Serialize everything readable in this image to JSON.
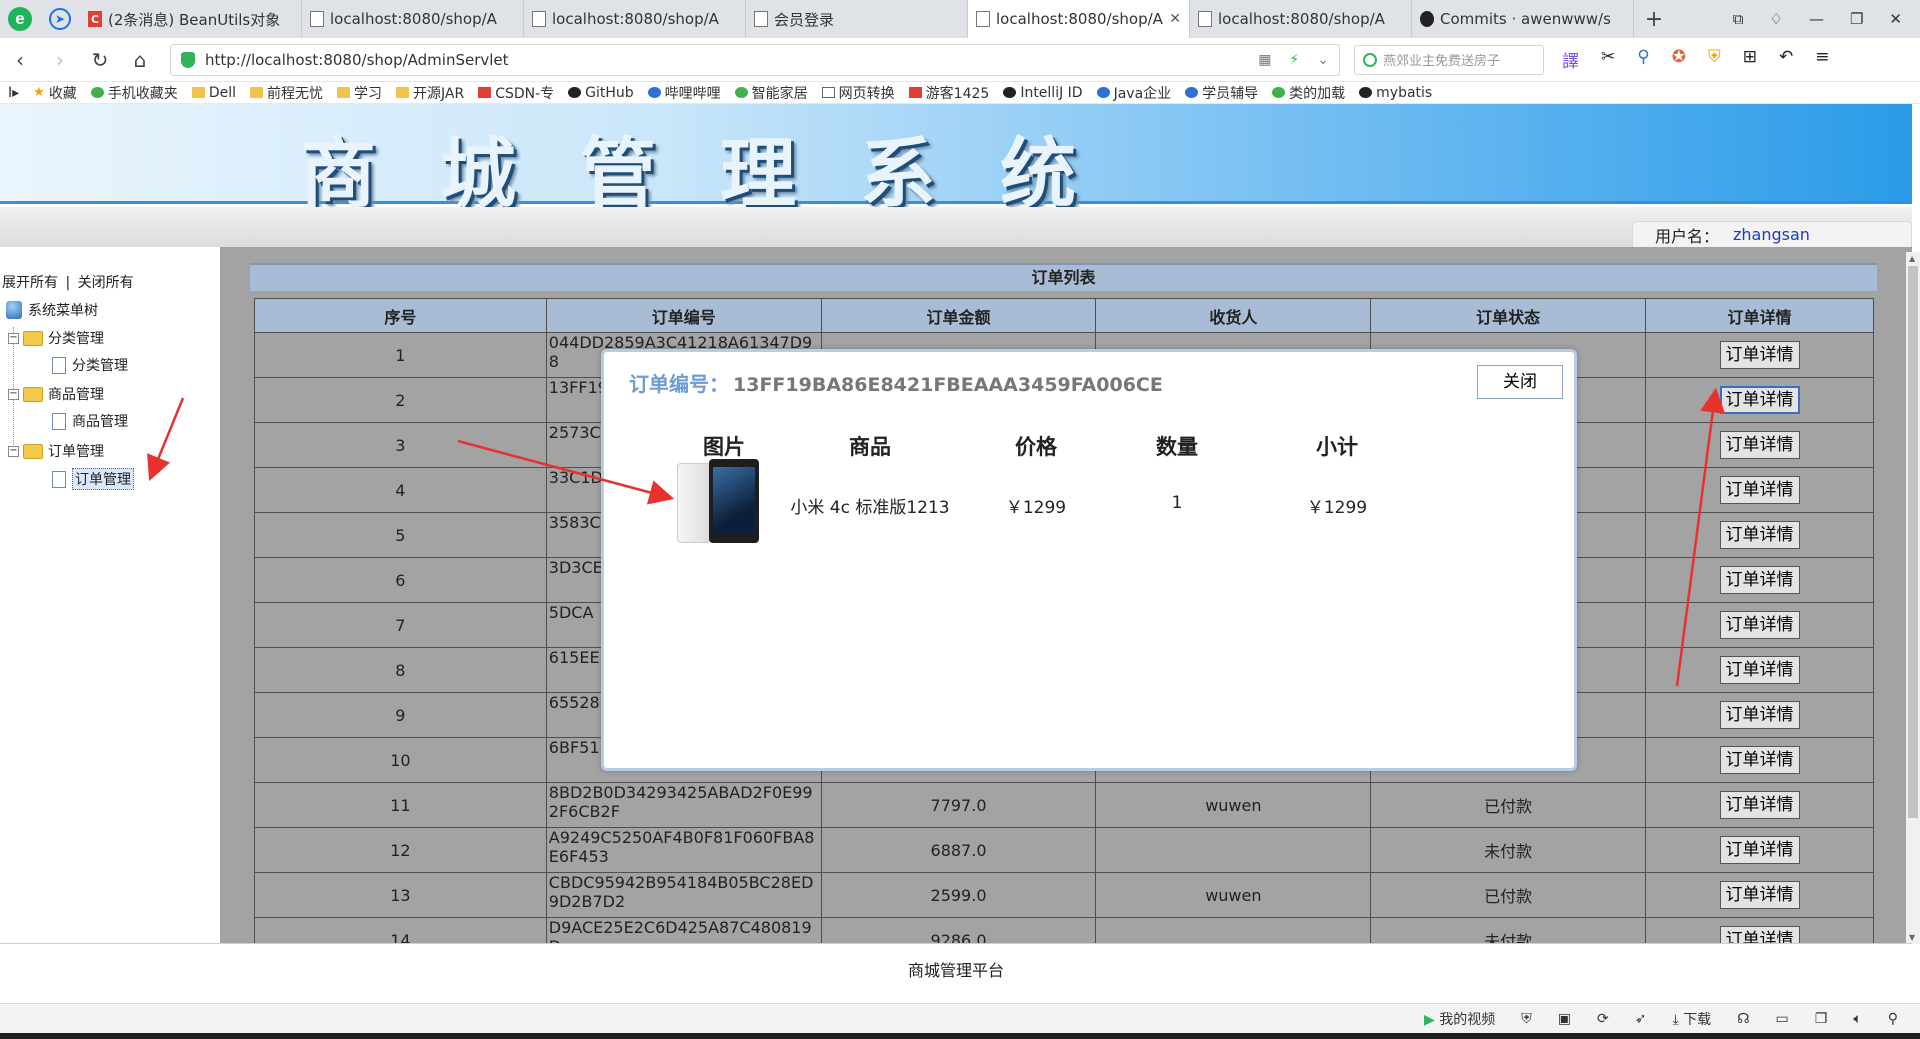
{
  "browser": {
    "tabs": [
      {
        "title": "(2条消息) BeanUtils对象",
        "icon": "csdn-icon"
      },
      {
        "title": "localhost:8080/shop/A",
        "icon": "page-icon"
      },
      {
        "title": "localhost:8080/shop/A",
        "icon": "page-icon"
      },
      {
        "title": "会员登录",
        "icon": "page-icon"
      },
      {
        "title": "localhost:8080/shop/A",
        "icon": "page-icon",
        "active": true
      },
      {
        "title": "localhost:8080/shop/A",
        "icon": "page-icon"
      },
      {
        "title": "Commits · awenwww/s",
        "icon": "github-icon"
      }
    ],
    "url": "http://localhost:8080/shop/AdminServlet",
    "search_placeholder": "燕郊业主免费送房子",
    "bookmarks": [
      "收藏",
      "手机收藏夹",
      "Dell",
      "前程无忧",
      "学习",
      "开源JAR",
      "CSDN-专",
      "GitHub",
      "哔哩哔哩",
      "智能家居",
      "网页转换",
      "游客1425",
      "IntelliJ ID",
      "Java企业",
      "学员辅导",
      "类的加载",
      "mybatis"
    ]
  },
  "header": {
    "title": "商城管理系统",
    "user_label": "用户名：",
    "username": "zhangsan"
  },
  "sidebar": {
    "expand_all": "展开所有",
    "separator": "|",
    "collapse_all": "关闭所有",
    "root": "系统菜单树",
    "groups": [
      {
        "label": "分类管理",
        "child": "分类管理"
      },
      {
        "label": "商品管理",
        "child": "商品管理"
      },
      {
        "label": "订单管理",
        "child": "订单管理"
      }
    ]
  },
  "orders": {
    "caption": "订单列表",
    "columns": [
      "序号",
      "订单编号",
      "订单金额",
      "收货人",
      "订单状态",
      "订单详情"
    ],
    "detail_button": "订单详情",
    "rows": [
      {
        "no": "1",
        "id": "044DD2859A3C41218A61347D98",
        "amount": "",
        "receiver": "",
        "status": ""
      },
      {
        "no": "2",
        "id": "13FF19",
        "amount": "",
        "receiver": "",
        "status": ""
      },
      {
        "no": "3",
        "id": "2573C",
        "amount": "",
        "receiver": "",
        "status": ""
      },
      {
        "no": "4",
        "id": "33C1D",
        "amount": "",
        "receiver": "",
        "status": ""
      },
      {
        "no": "5",
        "id": "3583C",
        "amount": "",
        "receiver": "",
        "status": ""
      },
      {
        "no": "6",
        "id": "3D3CE",
        "amount": "",
        "receiver": "",
        "status": ""
      },
      {
        "no": "7",
        "id": "5DCA",
        "amount": "",
        "receiver": "",
        "status": ""
      },
      {
        "no": "8",
        "id": "615EE",
        "amount": "",
        "receiver": "",
        "status": ""
      },
      {
        "no": "9",
        "id": "65528",
        "amount": "",
        "receiver": "",
        "status": ""
      },
      {
        "no": "10",
        "id": "6BF51",
        "amount": "",
        "receiver": "",
        "status": ""
      },
      {
        "no": "11",
        "id": "8BD2B0D34293425ABAD2F0E992F6CB2F",
        "amount": "7797.0",
        "receiver": "wuwen",
        "status": "已付款"
      },
      {
        "no": "12",
        "id": "A9249C5250AF4B0F81F060FBA8E6F453",
        "amount": "6887.0",
        "receiver": "",
        "status": "未付款"
      },
      {
        "no": "13",
        "id": "CBDC95942B954184B05BC28ED9D2B7D2",
        "amount": "2599.0",
        "receiver": "wuwen",
        "status": "已付款"
      },
      {
        "no": "14",
        "id": "D9ACE25E2C6D425A87C480819D",
        "amount": "9286.0",
        "receiver": "",
        "status": "未付款"
      }
    ]
  },
  "modal": {
    "title_label": "订单编号：",
    "order_id": "13FF19BA86E8421FBEAAA3459FA006CE",
    "close_label": "关闭",
    "columns": [
      "图片",
      "商品",
      "价格",
      "数量",
      "小计"
    ],
    "item": {
      "name": "小米 4c 标准版1213",
      "price": "￥1299",
      "qty": "1",
      "subtotal": "￥1299"
    }
  },
  "footer": {
    "text": "商城管理平台"
  },
  "statusbar": {
    "my_video": "我的视频",
    "download": "下载"
  },
  "colors": {
    "banner_accent": "#2a9be8",
    "table_header": "#a9bcd5",
    "content_bg": "#a3a3a3",
    "annotation_arrow": "#e8322f"
  }
}
